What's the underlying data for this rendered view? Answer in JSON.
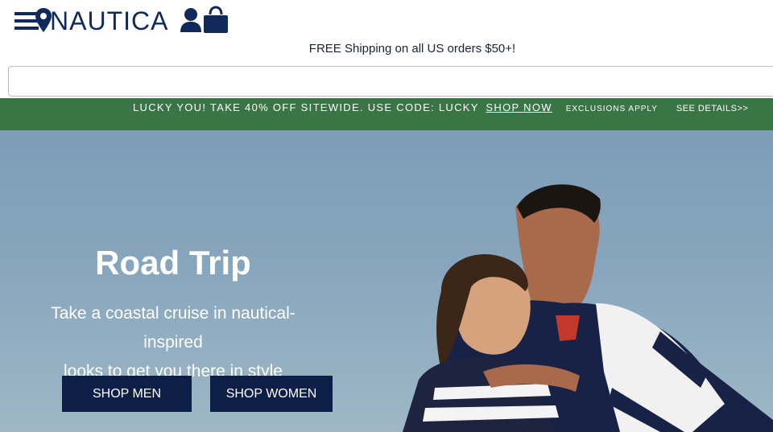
{
  "header": {
    "logo": "NAUTICA",
    "icons": [
      "menu-icon",
      "location-pin-icon",
      "user-icon",
      "shopping-bag-icon"
    ]
  },
  "shipping_banner": "FREE Shipping on all US orders $50+!",
  "search": {
    "value": "",
    "placeholder": ""
  },
  "promo": {
    "text": "LUCKY YOU! TAKE 40% OFF SITEWIDE. USE CODE: LUCKY",
    "link": "SHOP NOW",
    "exclusions": "EXCLUSIONS APPLY",
    "details": "SEE DETAILS>>",
    "color": "#3a7546"
  },
  "hero": {
    "title": "Road Trip",
    "subtitle_line1": "Take a coastal cruise in nautical-inspired",
    "subtitle_line2": "looks to get you there in style",
    "buttons": {
      "men": "SHOP MEN",
      "women": "SHOP WOMEN"
    }
  },
  "colors": {
    "navy": "#0d1f47",
    "logo": "#0f2a5a",
    "sky": "#87a6bd"
  }
}
